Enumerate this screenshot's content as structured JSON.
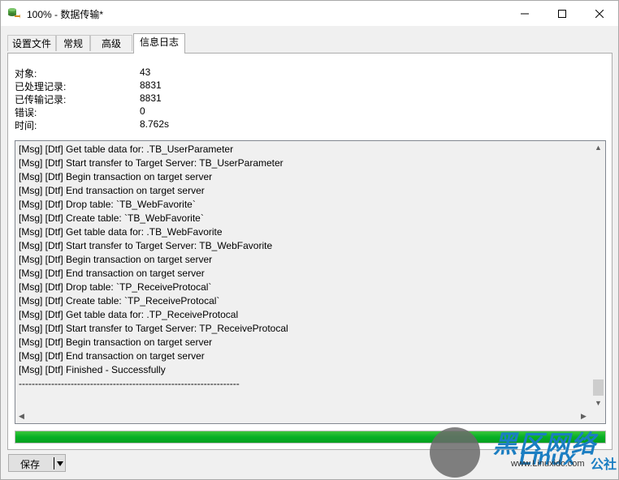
{
  "window": {
    "title": "100% - 数据传输*"
  },
  "tabs": [
    {
      "label": "设置文件",
      "active": false
    },
    {
      "label": "常规",
      "active": false
    },
    {
      "label": "高级",
      "active": false
    },
    {
      "label": "信息日志",
      "active": true
    }
  ],
  "stats": [
    {
      "label": "对象:",
      "value": "43"
    },
    {
      "label": "已处理记录:",
      "value": "8831"
    },
    {
      "label": "已传输记录:",
      "value": "8831"
    },
    {
      "label": "错误:",
      "value": "0"
    },
    {
      "label": "时间:",
      "value": "8.762s"
    }
  ],
  "log": [
    "[Msg] [Dtf] Get table data for: .TB_UserParameter",
    "[Msg] [Dtf] Start transfer to Target Server: TB_UserParameter",
    "[Msg] [Dtf] Begin transaction on target server",
    "[Msg] [Dtf] End transaction on target server",
    "[Msg] [Dtf] Drop table: `TB_WebFavorite`",
    "[Msg] [Dtf] Create table: `TB_WebFavorite`",
    "[Msg] [Dtf] Get table data for: .TB_WebFavorite",
    "[Msg] [Dtf] Start transfer to Target Server: TB_WebFavorite",
    "[Msg] [Dtf] Begin transaction on target server",
    "[Msg] [Dtf] End transaction on target server",
    "[Msg] [Dtf] Drop table: `TP_ReceiveProtocal`",
    "[Msg] [Dtf] Create table: `TP_ReceiveProtocal`",
    "[Msg] [Dtf] Get table data for: .TP_ReceiveProtocal",
    "[Msg] [Dtf] Start transfer to Target Server: TP_ReceiveProtocal",
    "[Msg] [Dtf] Begin transaction on target server",
    "[Msg] [Dtf] End transaction on target server",
    "[Msg] [Dtf] Finished - Successfully",
    "--------------------------------------------------------------------"
  ],
  "progress": {
    "percent": 100,
    "color": "#06b025"
  },
  "footer": {
    "save_label": "保存"
  },
  "watermark": {
    "title": "黑区网络",
    "brand": "Linux",
    "suffix": "公社",
    "site": "www.Linuxidc.com"
  },
  "icons": {
    "app": "database-transfer-icon",
    "minimize": "minimize-icon",
    "maximize": "maximize-icon",
    "close": "close-icon"
  }
}
